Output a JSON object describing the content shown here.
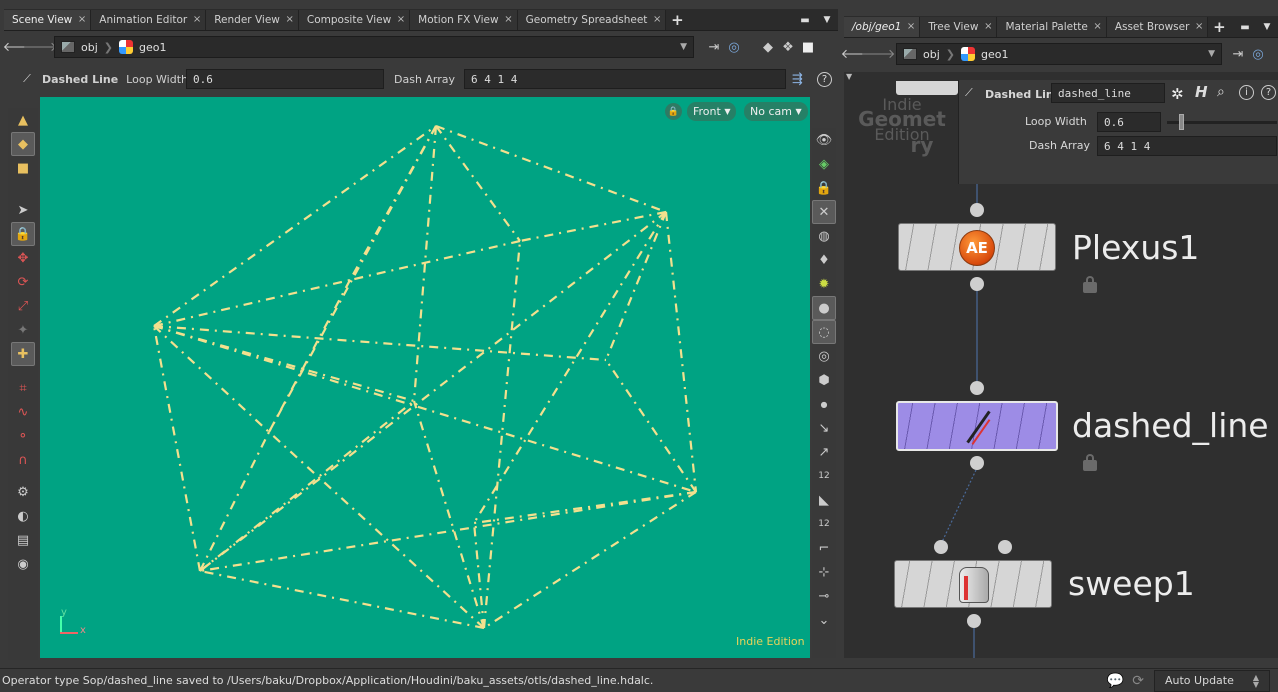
{
  "left_tabs": [
    {
      "label": "Scene View",
      "active": true
    },
    {
      "label": "Animation Editor",
      "active": false
    },
    {
      "label": "Render View",
      "active": false
    },
    {
      "label": "Composite View",
      "active": false
    },
    {
      "label": "Motion FX View",
      "active": false
    },
    {
      "label": "Geometry Spreadsheet",
      "active": false
    }
  ],
  "right_tabs": [
    {
      "label": "/obj/geo1",
      "active": true
    },
    {
      "label": "Tree View",
      "active": false
    },
    {
      "label": "Material Palette",
      "active": false
    },
    {
      "label": "Asset Browser",
      "active": false
    }
  ],
  "left_path": {
    "root": "obj",
    "node": "geo1"
  },
  "right_path": {
    "root": "obj",
    "node": "geo1"
  },
  "op_toolbar": {
    "tool_name": "Dashed Line",
    "loop_width_label": "Loop Width",
    "loop_width_value": "0.6",
    "dash_array_label": "Dash Array",
    "dash_array_value": "6 4 1 4"
  },
  "viewport": {
    "view_menu": "Front",
    "camera_menu": "No cam",
    "watermark": "Indie Edition",
    "axis_y": "y",
    "axis_x": "x",
    "background": "#00a383",
    "line_color": "#f3e08e"
  },
  "network": {
    "watermark_lines": [
      "Indie",
      "Geomet",
      "Edition",
      "ry"
    ],
    "parm_panel": {
      "type_label": "Dashed Line",
      "node_name": "dashed_line",
      "loop_width_label": "Loop Width",
      "loop_width_value": "0.6",
      "dash_array_label": "Dash Array",
      "dash_array_value": "6 4 1 4"
    },
    "nodes": [
      {
        "name": "Plexus1",
        "icon_text": "AE"
      },
      {
        "name": "dashed_line",
        "selected_color": "#9d8ce6"
      },
      {
        "name": "sweep1"
      }
    ]
  },
  "status": {
    "message": "Operator type Sop/dashed_line saved to /Users/baku/Dropbox/Application/Houdini/baku_assets/otls/dashed_line.hdalc.",
    "update_mode": "Auto Update"
  }
}
